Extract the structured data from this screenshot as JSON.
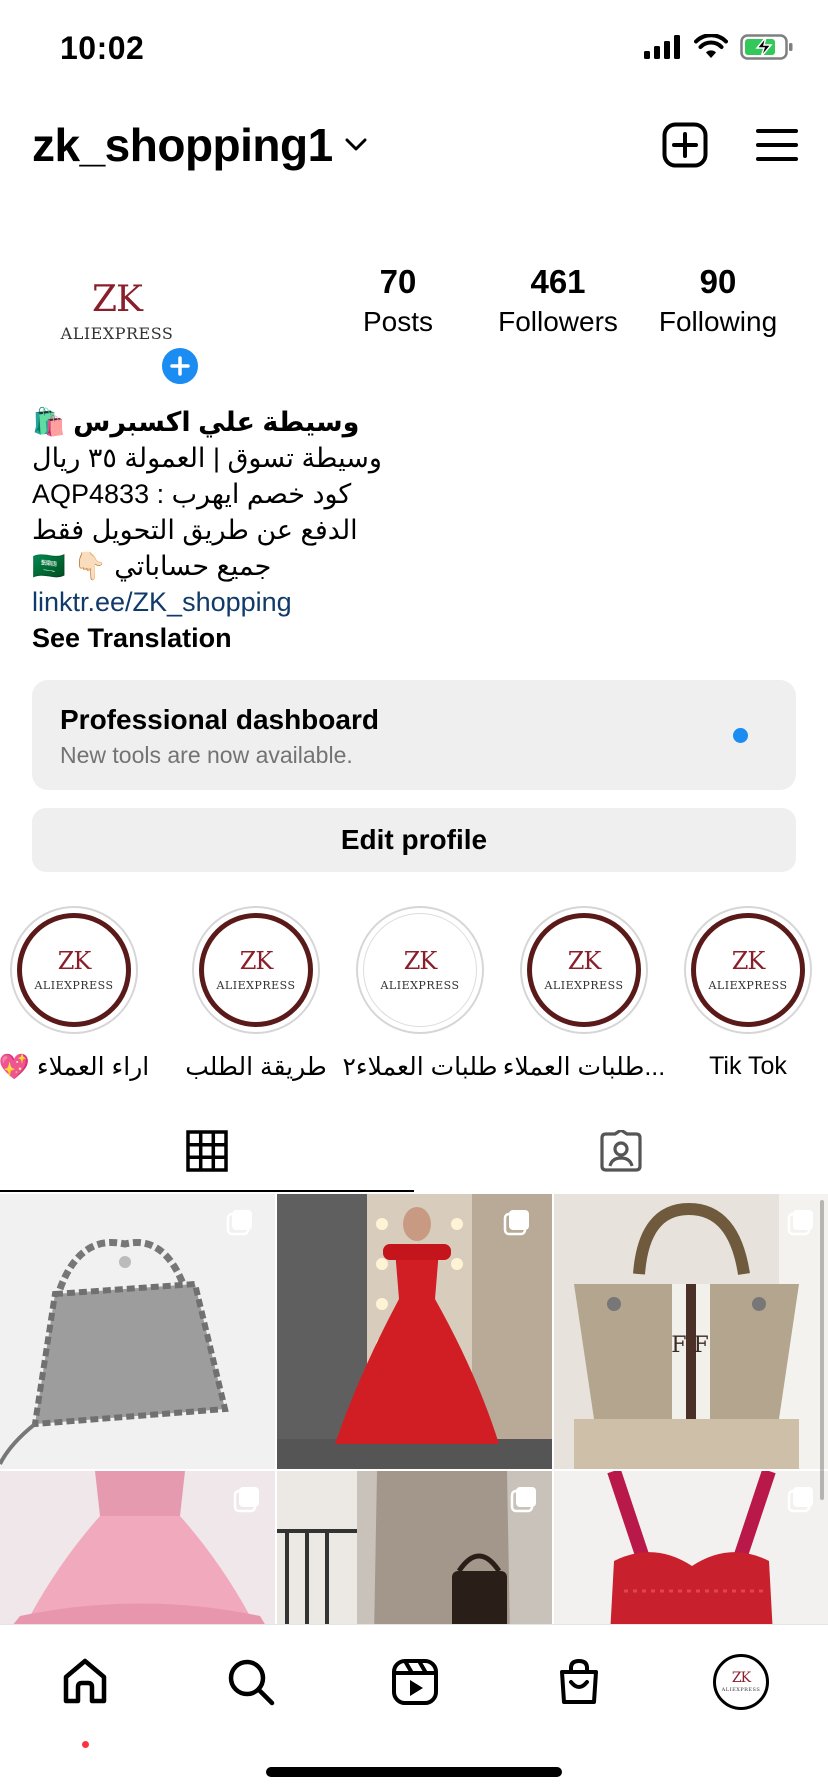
{
  "status_bar": {
    "time": "10:02"
  },
  "header": {
    "username": "zk_shopping1"
  },
  "avatar": {
    "brand_top": "ZK",
    "brand_bottom": "ALIEXPRESS"
  },
  "stats": [
    {
      "value": "70",
      "label": "Posts"
    },
    {
      "value": "461",
      "label": "Followers"
    },
    {
      "value": "90",
      "label": "Following"
    }
  ],
  "bio": {
    "name": "وسيطة علي اكسبرس 🛍️",
    "line1": "وسيطة تسوق | العمولة ٣٥ ريال",
    "line2": "كود خصم ايهرب : AQP4833",
    "line3": "الدفع عن طريق التحويل فقط",
    "line4": "جميع حساباتي 👇🏻 🇸🇦",
    "link": "linktr.ee/ZK_shopping",
    "see_translation": "See Translation"
  },
  "dashboard": {
    "title": "Professional dashboard",
    "subtitle": "New tools are now available."
  },
  "edit_profile": "Edit profile",
  "highlights": [
    {
      "label": "💖 اراء العملاء"
    },
    {
      "label": "طريقة الطلب"
    },
    {
      "label": "طلبات العملاء٢"
    },
    {
      "label": "طلبات العملاء..."
    },
    {
      "label": "Tik Tok"
    }
  ],
  "highlight_logo": {
    "top": "ZK",
    "bottom": "ALIEXPRESS"
  },
  "colors": {
    "accent": "#1b8cf1",
    "link": "#0f3a69",
    "button_bg": "#efefef",
    "highlight_ring": "#5a1a1a",
    "brand_red": "#8a1e2a"
  },
  "icons": {
    "header": [
      "chevron-down-icon",
      "new-post-icon",
      "menu-icon"
    ],
    "tabs": [
      "grid-icon",
      "tagged-icon"
    ],
    "nav": [
      "home-icon",
      "search-icon",
      "reels-icon",
      "shop-icon",
      "profile-avatar"
    ]
  }
}
